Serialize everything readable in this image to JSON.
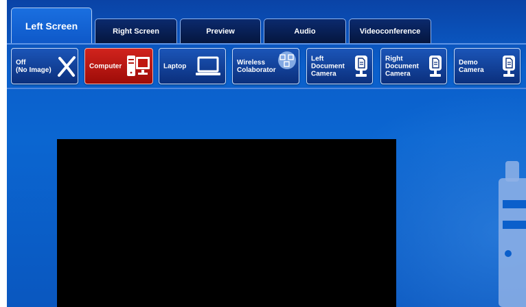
{
  "tabs": [
    {
      "label": "Left Screen",
      "active": true
    },
    {
      "label": "Right Screen",
      "active": false
    },
    {
      "label": "Preview",
      "active": false
    },
    {
      "label": "Audio",
      "active": false
    },
    {
      "label": "Videoconference",
      "active": false
    }
  ],
  "sources": [
    {
      "label": "Off\n(No Image)",
      "icon": "x-icon",
      "selected": false
    },
    {
      "label": "Computer",
      "icon": "computer-icon",
      "selected": true
    },
    {
      "label": "Laptop",
      "icon": "laptop-icon",
      "selected": false
    },
    {
      "label": "Wireless\nColaborator",
      "icon": "wireless-collaborator-icon",
      "selected": false
    },
    {
      "label": "Left\nDocument\nCamera",
      "icon": "document-camera-icon",
      "selected": false
    },
    {
      "label": "Right\nDocument\nCamera",
      "icon": "document-camera-icon",
      "selected": false
    },
    {
      "label": "Demo\nCamera",
      "icon": "document-camera-icon",
      "selected": false
    }
  ],
  "colors": {
    "selected": "#c0160f",
    "button": "#0b3a90",
    "background": "#0b5fcb"
  }
}
